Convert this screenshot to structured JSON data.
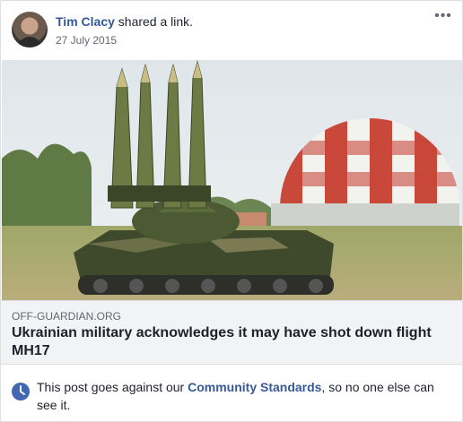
{
  "post": {
    "author": "Tim Clacy",
    "action": " shared a link.",
    "date": "27 July 2015",
    "more_icon": "ellipsis-icon"
  },
  "link": {
    "image_icon": "missile-launcher-photo",
    "domain": "OFF-GUARDIAN.ORG",
    "title": "Ukrainian military acknowledges it may have shot down flight MH17"
  },
  "notice": {
    "icon": "clock-icon",
    "text_before": "This post goes against our ",
    "link_text": "Community Standards",
    "text_after": ", so no one else can see it."
  },
  "colors": {
    "link_blue": "#365899",
    "meta_bg": "#f2f3f5",
    "notice_icon": "#4267b2"
  }
}
